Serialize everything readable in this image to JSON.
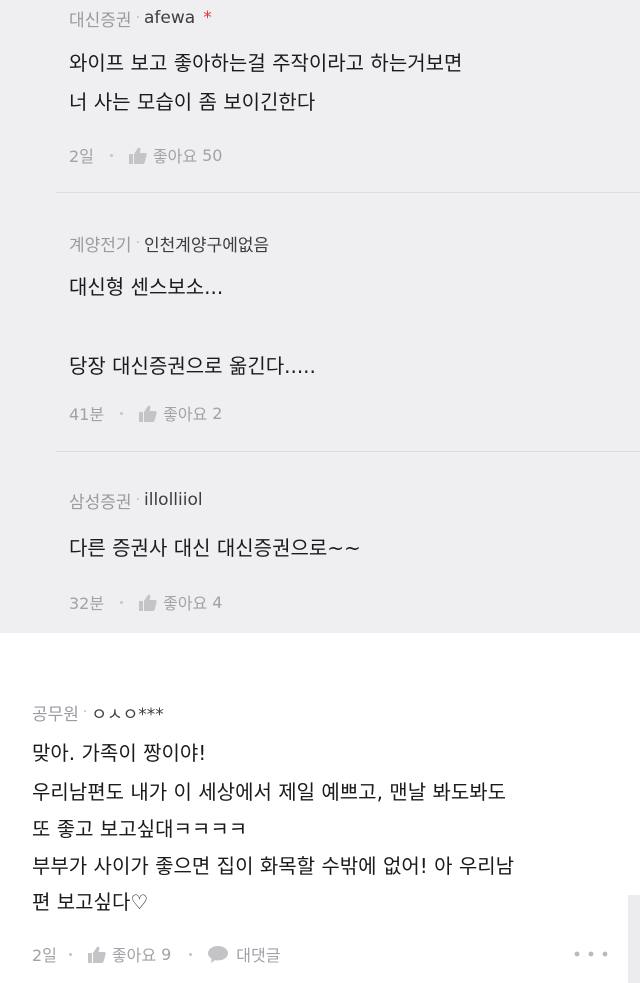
{
  "replies": [
    {
      "company": "대신증권",
      "nickname": "afewa",
      "star": "*",
      "lines": [
        "와이프 보고 좋아하는걸 주작이라고 하는거보면",
        "너 사는 모습이 좀 보이긴한다"
      ],
      "time": "2일",
      "like_label": "좋아요",
      "like_count": "50"
    },
    {
      "company": "계양전기",
      "nickname": "인천계양구에없음",
      "lines": [
        "대신형 센스보소...",
        "",
        "당장 대신증권으로 옮긴다....."
      ],
      "time": "41분",
      "like_label": "좋아요",
      "like_count": "2"
    },
    {
      "company": "삼성증권",
      "nickname": "illolliiol",
      "lines": [
        "다른 증권사 대신 대신증권으로~~"
      ],
      "time": "32분",
      "like_label": "좋아요",
      "like_count": "4"
    }
  ],
  "main_comment": {
    "company": "공무원",
    "nickname": "ㅇㅅㅇ***",
    "lines": [
      "맞아. 가족이 짱이야!",
      "우리남편도 내가 이 세상에서 제일 예쁘고, 맨날 봐도봐도",
      "또 좋고 보고싶대ㅋㅋㅋㅋ",
      "부부가 사이가 좋으면 집이 화목할 수밖에 없어! 아 우리남",
      "편 보고싶다♡"
    ],
    "time": "2일",
    "like_label": "좋아요",
    "like_count": "9",
    "reply_label": "대댓글"
  },
  "icons": {
    "like": "thumbs-up-icon",
    "reply": "speech-bubble-icon",
    "more": "more-dots-icon"
  },
  "colors": {
    "nested_background": "#efeff2",
    "star": "#e0323c"
  }
}
